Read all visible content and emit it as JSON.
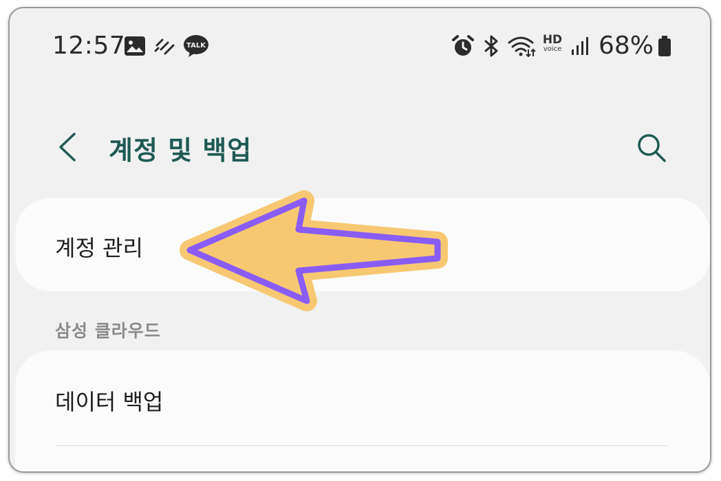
{
  "status_bar": {
    "time": "12:57",
    "battery": "68%",
    "hd_label": "HD",
    "hd_sub": "voice",
    "left_icons": [
      "gallery-icon",
      "weather-icon",
      "kakaotalk-icon"
    ],
    "kakao_label": "TALK",
    "right_icons": [
      "alarm-icon",
      "bluetooth-icon",
      "wifi-icon",
      "hd-voice-icon",
      "signal-icon",
      "battery-icon"
    ]
  },
  "header": {
    "title": "계정 및 백업",
    "back_icon": "chevron-left-icon",
    "search_icon": "search-icon"
  },
  "items": {
    "account_management": "계정 관리",
    "section_samsung_cloud": "삼성 클라우드",
    "data_backup": "데이터 백업"
  },
  "colors": {
    "accent": "#1f5a54",
    "arrow_fill": "#f7c872",
    "arrow_stroke": "#8a5cf5",
    "background": "#f1f1f1",
    "card": "#fbfbfb"
  }
}
